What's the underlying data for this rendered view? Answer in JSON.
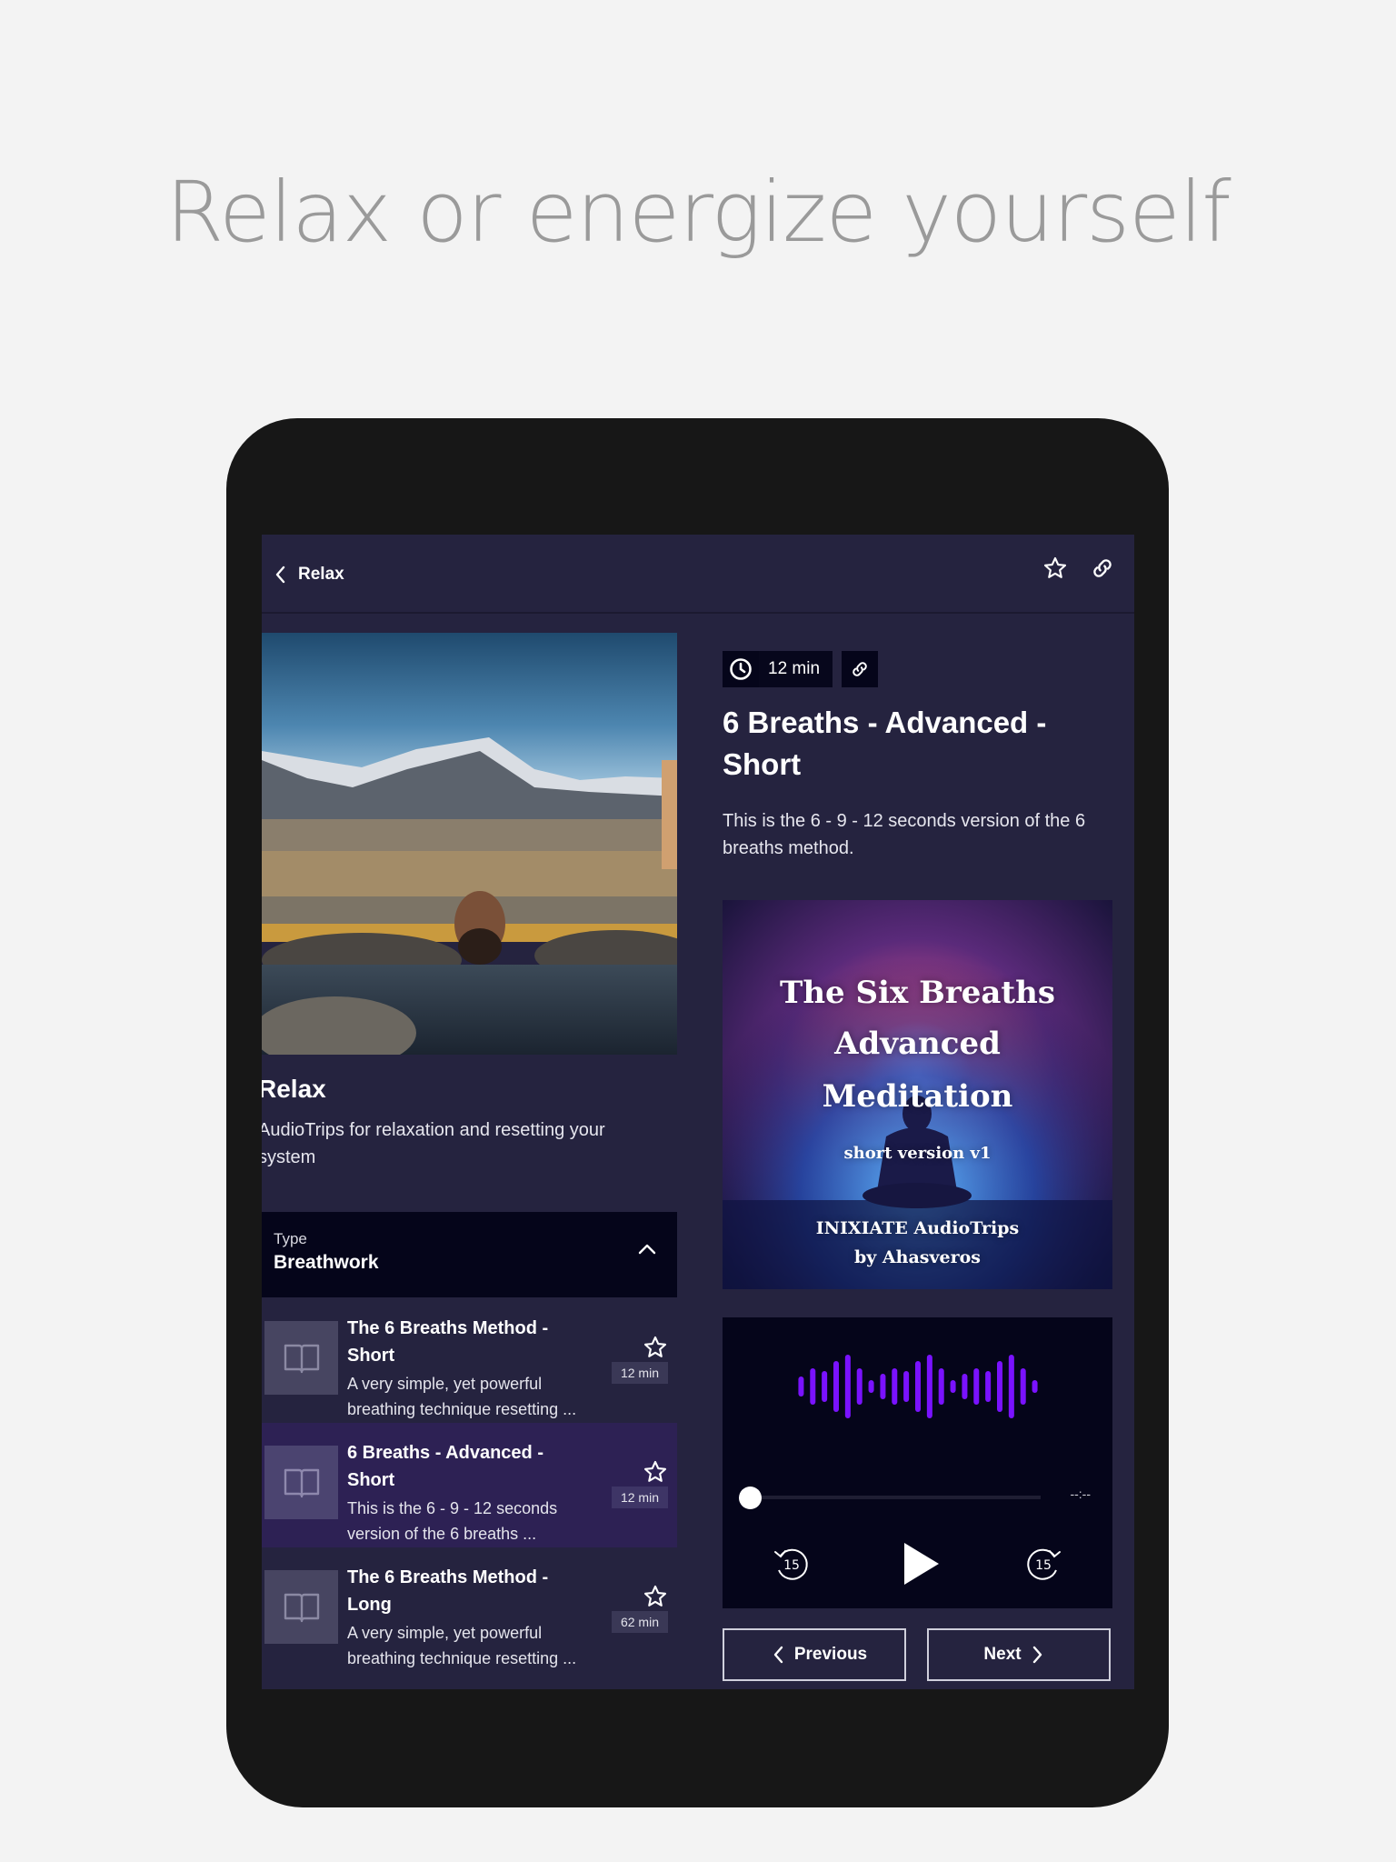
{
  "headline": "Relax or energize yourself",
  "app_bar": {
    "back_label": "Relax",
    "back_icon": "chevron-left-icon",
    "actions": [
      "star-icon",
      "link-icon"
    ]
  },
  "category": {
    "title": "Relax",
    "description": "AudioTrips for relaxation and resetting your system",
    "hero_image": "man relaxing in hot spring with snowy mountains"
  },
  "filter": {
    "label": "Type",
    "value": "Breathwork",
    "icon": "chevron-up-icon"
  },
  "tracks": [
    {
      "title": "The 6 Breaths Method - Short",
      "description": "A very simple, yet powerful breathing technique resetting ...",
      "duration": "12 min",
      "active": false
    },
    {
      "title": "6 Breaths - Advanced - Short",
      "description": "This is the 6 - 9 - 12 seconds version of the 6 breaths ...",
      "duration": "12 min",
      "active": true
    },
    {
      "title": "The 6 Breaths Method - Long",
      "description": "A very simple, yet powerful breathing technique resetting ...",
      "duration": "62 min",
      "active": false
    }
  ],
  "detail": {
    "duration": "12 min",
    "title": "6 Breaths - Advanced - Short",
    "description": "This is the 6 - 9 - 12 seconds version of the 6 breaths method.",
    "cover": {
      "line1": "The Six Breaths",
      "line2": "Advanced",
      "line3": "Meditation",
      "subtitle": "short version v1",
      "credit1": "INIXIATE AudioTrips",
      "credit2": "by Ahasveros"
    }
  },
  "player": {
    "progress": 0,
    "time_remaining": "--:--",
    "rewind_seconds": "15",
    "forward_seconds": "15",
    "accent_color": "#7a12ff"
  },
  "navigation": {
    "previous_label": "Previous",
    "next_label": "Next"
  }
}
